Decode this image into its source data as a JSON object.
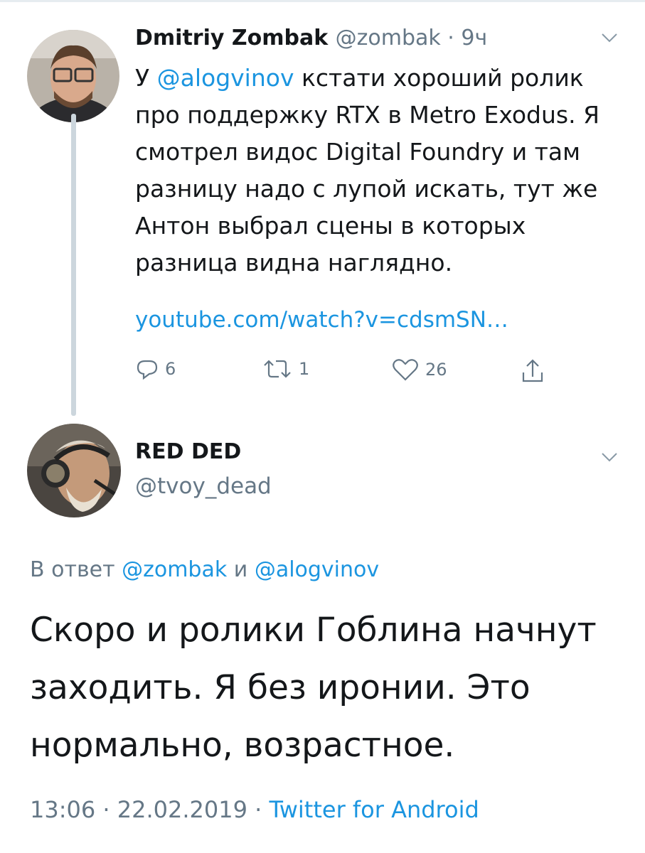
{
  "tweet1": {
    "author_name": "Dmitriy Zombak",
    "author_handle": "@zombak",
    "separator": " · ",
    "time": "9ч",
    "text_prefix": "У ",
    "mention": "@alogvinov",
    "text_rest": " кстати хороший ролик про поддержку RTX в Metro Exodus. Я смотрел видос Digital Foundry и там разницу надо с лупой искать, тут же Антон выбрал сцены в которых разница видна наглядно.",
    "link": "youtube.com/watch?v=cdsmSN…",
    "replies": "6",
    "retweets": "1",
    "likes": "26"
  },
  "tweet2": {
    "author_name": "RED DED",
    "author_handle": "@tvoy_dead",
    "reply_prefix": "В ответ ",
    "reply_mention1": "@zombak",
    "reply_and": " и ",
    "reply_mention2": "@alogvinov",
    "text": "Скоро и ролики Гоблина начнут заходить. Я без иронии. Это нормально, возрастное.",
    "time": "13:06",
    "date": "22.02.2019",
    "separator": " · ",
    "source": "Twitter for Android"
  },
  "colors": {
    "link": "#1b95e0",
    "secondary": "#657786",
    "text": "#14171a"
  },
  "icons": [
    "reply-icon",
    "retweet-icon",
    "like-icon",
    "share-icon",
    "chevron-down-icon"
  ]
}
